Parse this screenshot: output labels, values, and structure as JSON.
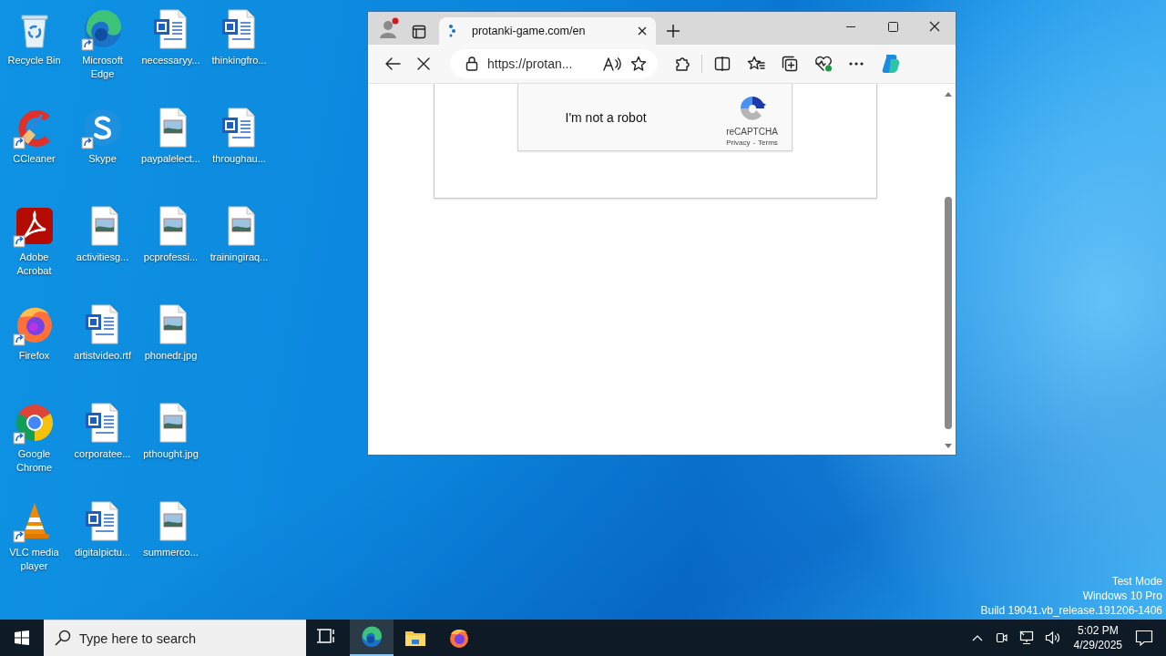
{
  "desktop": {
    "icons": [
      {
        "label": "Recycle Bin",
        "kind": "recycle",
        "shortcut": false
      },
      {
        "label": "CCleaner",
        "kind": "ccleaner",
        "shortcut": true
      },
      {
        "label": "Adobe Acrobat",
        "kind": "acrobat",
        "shortcut": true
      },
      {
        "label": "Firefox",
        "kind": "firefox",
        "shortcut": true
      },
      {
        "label": "Google Chrome",
        "kind": "chrome",
        "shortcut": true
      },
      {
        "label": "VLC media player",
        "kind": "vlc",
        "shortcut": true
      },
      {
        "label": "Microsoft Edge",
        "kind": "edge",
        "shortcut": true
      },
      {
        "label": "Skype",
        "kind": "skype",
        "shortcut": true
      },
      {
        "label": "activitiesg...",
        "kind": "image",
        "shortcut": false
      },
      {
        "label": "artistvideo.rtf",
        "kind": "word",
        "shortcut": false
      },
      {
        "label": "corporatee...",
        "kind": "word",
        "shortcut": false
      },
      {
        "label": "digitalpictu...",
        "kind": "word",
        "shortcut": false
      },
      {
        "label": "necessaryy...",
        "kind": "word",
        "shortcut": false
      },
      {
        "label": "paypalelect...",
        "kind": "image",
        "shortcut": false
      },
      {
        "label": "pcprofessi...",
        "kind": "image",
        "shortcut": false
      },
      {
        "label": "phonedr.jpg",
        "kind": "image",
        "shortcut": false
      },
      {
        "label": "pthought.jpg",
        "kind": "image",
        "shortcut": false
      },
      {
        "label": "summerco...",
        "kind": "image",
        "shortcut": false
      },
      {
        "label": "thinkingfro...",
        "kind": "word",
        "shortcut": false
      },
      {
        "label": "throughau...",
        "kind": "word",
        "shortcut": false
      },
      {
        "label": "trainingiraq...",
        "kind": "image",
        "shortcut": false
      }
    ]
  },
  "browser": {
    "profile_notification": true,
    "tabs": [
      {
        "title": "protanki-game.com/en",
        "selected": true,
        "loading": true
      }
    ],
    "loading": true,
    "address": "https://protan...",
    "page": {
      "captcha": {
        "label": "I'm not a robot",
        "brand": "reCAPTCHA",
        "privacy_link": "Privacy",
        "separator": "-",
        "terms_link": "Terms"
      }
    }
  },
  "os_watermark": [
    "Test Mode",
    "Windows 10 Pro",
    "Build 19041.vb_release.191206-1406"
  ],
  "taskbar": {
    "search_placeholder": "Type here to search",
    "apps": [
      {
        "kind": "taskview",
        "active": false
      },
      {
        "kind": "edge",
        "active": true
      },
      {
        "kind": "explorer",
        "active": false
      },
      {
        "kind": "firefox",
        "active": false
      }
    ],
    "clock": {
      "time": "5:02 PM",
      "date": "4/29/2025"
    }
  }
}
